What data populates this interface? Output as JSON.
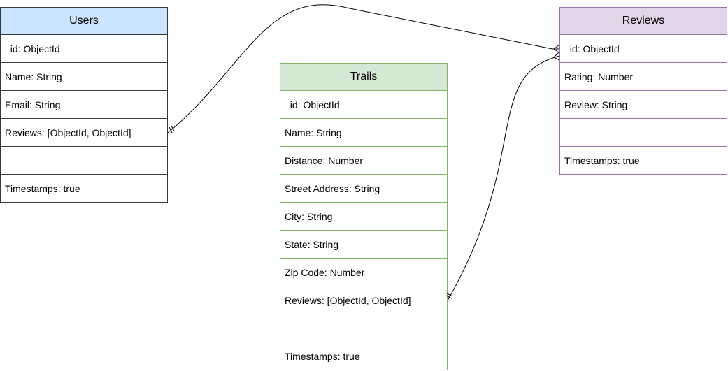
{
  "entities": {
    "users": {
      "title": "Users",
      "fields": [
        "_id: ObjectId",
        "Name: String",
        "Email: String",
        "Reviews: [ObjectId, ObjectId]",
        "",
        "Timestamps: true"
      ]
    },
    "trails": {
      "title": "Trails",
      "fields": [
        "_id: ObjectId",
        "Name: String",
        "Distance: Number",
        "Street Address: String",
        "City: String",
        "State: String",
        "Zip Code: Number",
        "Reviews: [ObjectId, ObjectId]",
        "",
        "Timestamps: true"
      ]
    },
    "reviews": {
      "title": "Reviews",
      "fields": [
        "_id: ObjectId",
        "Rating: Number",
        "Review: String",
        "",
        "Timestamps: true"
      ]
    }
  },
  "relations": [
    {
      "from": "users.Reviews",
      "to": "reviews._id",
      "from_end": "one-and-only-one",
      "to_end": "many"
    },
    {
      "from": "trails.Reviews",
      "to": "reviews._id",
      "from_end": "one-and-only-one",
      "to_end": "many"
    }
  ],
  "colors": {
    "users_header": "#cce5ff",
    "users_border": "#36393d",
    "trails_header": "#d5e8d4",
    "trails_border": "#82b366",
    "reviews_header": "#e1d5e7",
    "reviews_border": "#9673a6",
    "connector": "#000000"
  }
}
